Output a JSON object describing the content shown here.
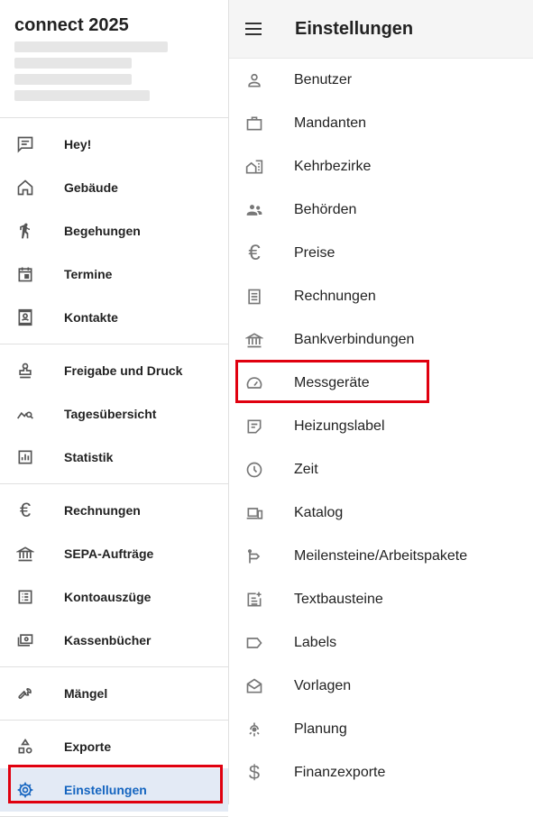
{
  "sidebar": {
    "app_title": "connect 2025",
    "groups": [
      [
        {
          "label": "Hey!",
          "icon": "message-icon"
        },
        {
          "label": "Gebäude",
          "icon": "home-icon"
        },
        {
          "label": "Begehungen",
          "icon": "walk-icon"
        },
        {
          "label": "Termine",
          "icon": "calendar-icon"
        },
        {
          "label": "Kontakte",
          "icon": "contact-card-icon"
        }
      ],
      [
        {
          "label": "Freigabe und Druck",
          "icon": "stamp-icon"
        },
        {
          "label": "Tagesübersicht",
          "icon": "trend-search-icon"
        },
        {
          "label": "Statistik",
          "icon": "chart-icon"
        }
      ],
      [
        {
          "label": "Rechnungen",
          "icon": "euro-icon"
        },
        {
          "label": "SEPA-Aufträge",
          "icon": "bank-icon"
        },
        {
          "label": "Kontoauszüge",
          "icon": "list-icon"
        },
        {
          "label": "Kassenbücher",
          "icon": "cash-icon"
        }
      ],
      [
        {
          "label": "Mängel",
          "icon": "wrench-icon"
        }
      ],
      [
        {
          "label": "Exporte",
          "icon": "shapes-icon"
        },
        {
          "label": "Einstellungen",
          "icon": "gear-icon"
        }
      ]
    ]
  },
  "header": {
    "title": "Einstellungen"
  },
  "settings": [
    {
      "label": "Benutzer",
      "icon": "person-icon"
    },
    {
      "label": "Mandanten",
      "icon": "briefcase-icon"
    },
    {
      "label": "Kehrbezirke",
      "icon": "district-icon"
    },
    {
      "label": "Behörden",
      "icon": "group-icon"
    },
    {
      "label": "Preise",
      "icon": "euro-icon"
    },
    {
      "label": "Rechnungen",
      "icon": "receipt-icon"
    },
    {
      "label": "Bankverbindungen",
      "icon": "bank-icon"
    },
    {
      "label": "Messgeräte",
      "icon": "gauge-icon"
    },
    {
      "label": "Heizungslabel",
      "icon": "note-icon"
    },
    {
      "label": "Zeit",
      "icon": "clock-icon"
    },
    {
      "label": "Katalog",
      "icon": "devices-icon"
    },
    {
      "label": "Meilensteine/Arbeitspakete",
      "icon": "milestone-icon"
    },
    {
      "label": "Textbausteine",
      "icon": "note-add-icon"
    },
    {
      "label": "Labels",
      "icon": "label-icon"
    },
    {
      "label": "Vorlagen",
      "icon": "envelope-icon"
    },
    {
      "label": "Planung",
      "icon": "planning-icon"
    },
    {
      "label": "Finanzexporte",
      "icon": "dollar-icon"
    }
  ],
  "active_sidebar_item": "Einstellungen",
  "highlighted_setting": "Messgeräte",
  "colors": {
    "accent": "#1565c0",
    "highlight": "#e0000f",
    "active_bg": "#e3eaf5"
  }
}
